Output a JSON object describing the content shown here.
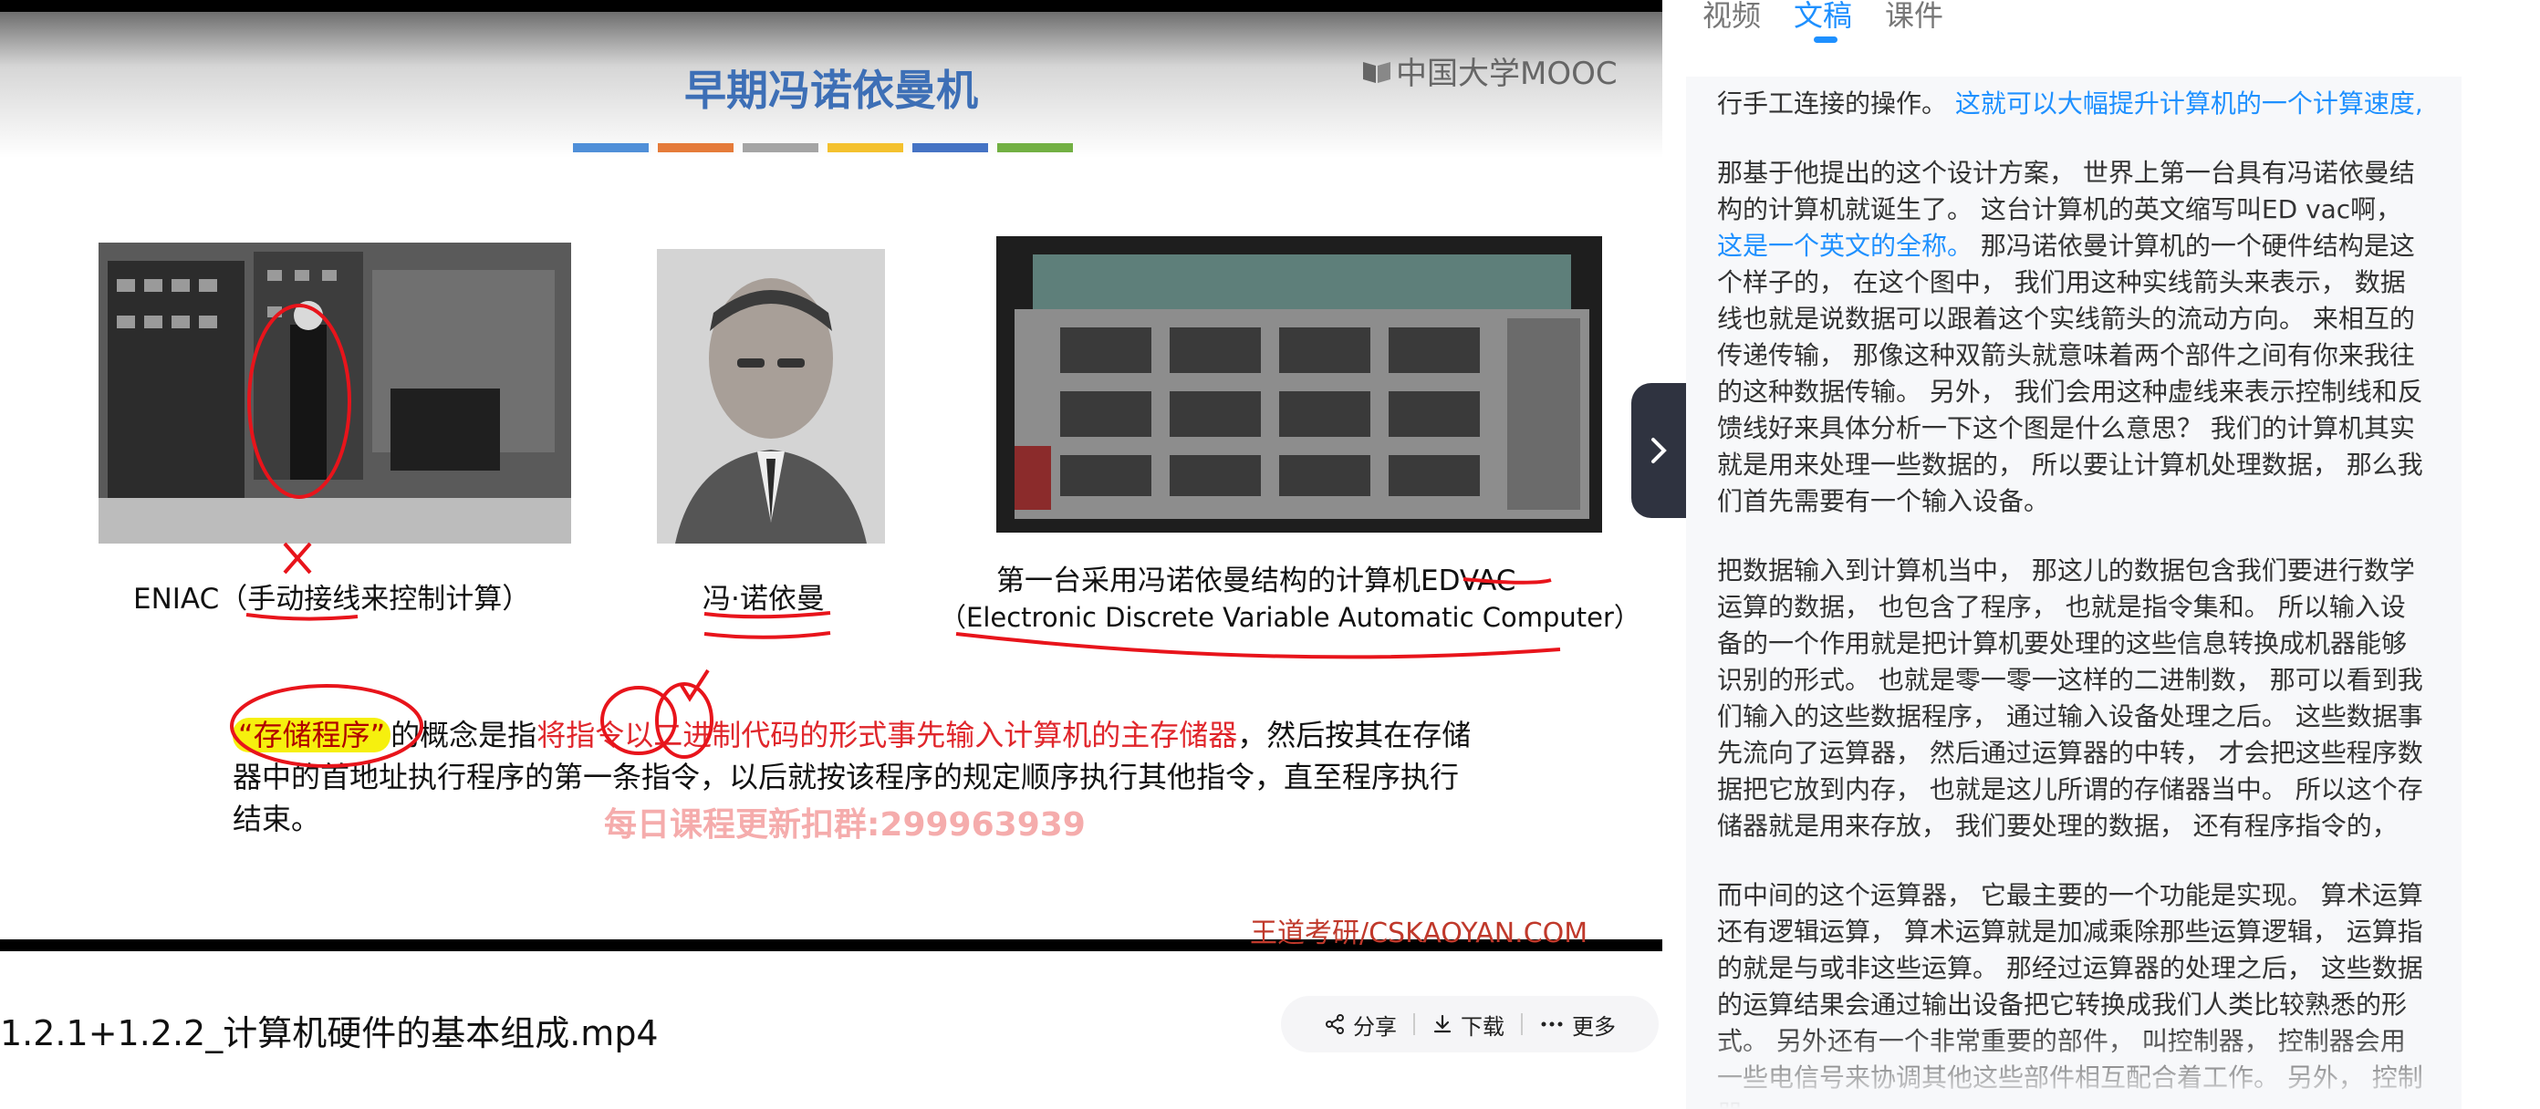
{
  "slide": {
    "title": "早期冯诺依曼机",
    "logo": "中国大学MOOC",
    "accent_bars": [
      "#4f8fd8",
      "#e57b3a",
      "#a5a5a5",
      "#f4c12e",
      "#4573c4",
      "#72b043"
    ],
    "caption_eniac_prefix": "ENIAC",
    "caption_eniac_paren": "（手动接线来控制计算）",
    "caption_vonneumann": "冯·诺依曼",
    "caption_edvac_line1": "第一台采用冯诺依曼结构的计算机EDVAC",
    "caption_edvac_line2": "（Electronic Discrete Variable Automatic Computer）",
    "para_highlight": "“存储程序”",
    "para_text1": "的概念是指",
    "para_red": "将指令以二进制代码的形式事先输入计算机的主存储器",
    "para_text2": "，然后按其在存储器中的首地址执行程序的第一条指令，以后就按该程序的规定顺序执行其他指令，直至程序执行结束。",
    "watermark": "每日课程更新扣群:299963939",
    "brand": "王道考研/CSKAOYAN.COM"
  },
  "video": {
    "title": "1.2.1+1.2.2_计算机硬件的基本组成.mp4",
    "actions": {
      "share": "分享",
      "download": "下载",
      "more": "更多"
    }
  },
  "panel": {
    "tabs": [
      "视频",
      "文稿",
      "课件"
    ],
    "active_tab": "文稿",
    "toggle_icon": "chevron-right-icon",
    "p1_text": "行手工连接的操作。",
    "p1_blue": "这就可以大幅提升计算机的一个计算速度,",
    "p2_text1": "那基于他提出的这个设计方案， 世界上第一台具有冯诺依曼结构的计算机就诞生了。 这台计算机的英文缩写叫ED vac啊，",
    "p2_blue": "这是一个英文的全称。",
    "p2_text2": "那冯诺依曼计算机的一个硬件结构是这个样子的， 在这个图中， 我们用这种实线箭头来表示， 数据线也就是说数据可以跟着这个实线箭头的流动方向。 来相互的传递传输， 那像这种双箭头就意味着两个部件之间有你来我往的这种数据传输。 另外， 我们会用这种虚线来表示控制线和反馈线好来具体分析一下这个图是什么意思？ 我们的计算机其实就是用来处理一些数据的， 所以要让计算机处理数据， 那么我们首先需要有一个输入设备。",
    "p3": "把数据输入到计算机当中， 那这儿的数据包含我们要进行数学运算的数据， 也包含了程序， 也就是指令集和。 所以输入设备的一个作用就是把计算机要处理的这些信息转换成机器能够识别的形式。 也就是零一零一这样的二进制数， 那可以看到我们输入的这些数据程序， 通过输入设备处理之后。 这些数据事先流向了运算器， 然后通过运算器的中转， 才会把这些程序数据把它放到内存， 也就是这儿所谓的存储器当中。 所以这个存储器就是用来存放， 我们要处理的数据， 还有程序指令的，",
    "p4": "而中间的这个运算器， 它最主要的一个功能是实现。 算术运算还有逻辑运算， 算术运算就是加减乘除那些运算逻辑， 运算指的就是与或非这些运算。 那经过运算器的处理之后， 这些数据的运算结果会通过输出设备把它转换成我们人类比较熟悉的形式。 另外还有一个非常重要的部件， 叫控制器， 控制器会用一些电信号来协调其他这些部件相互配合着工作。 另外， 控制器"
  }
}
